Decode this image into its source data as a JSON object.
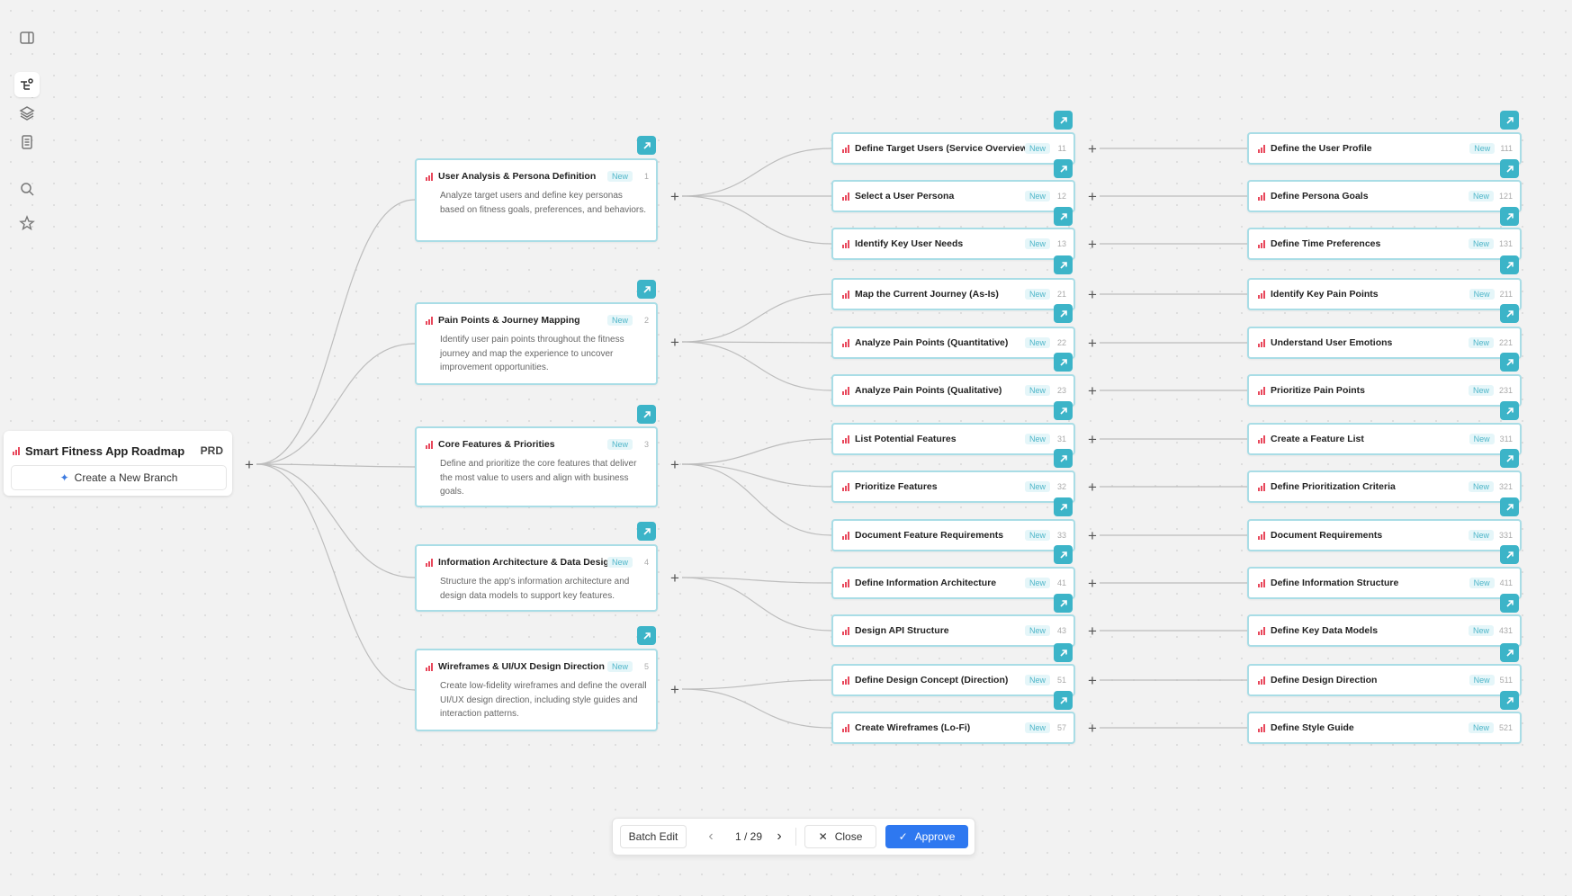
{
  "app": {
    "root": {
      "title": "Smart Fitness App Roadmap",
      "tag": "PRD",
      "branch_label": "Create a New Branch"
    },
    "rail_icons": [
      "sidebar-toggle-icon",
      "mindmap-icon",
      "layers-icon",
      "document-icon",
      "search-icon",
      "star-icon"
    ],
    "colors": {
      "accent": "#3cb4c8",
      "node_border": "#a9dde6",
      "badge_text": "#4fb6c9",
      "priority": "#e8475b",
      "approve": "#2e78f0"
    }
  },
  "nodes": [
    {
      "id": "1",
      "title": "User Analysis & Persona Definition",
      "badge": "New",
      "num": "1",
      "desc": "Analyze target users and define key personas based on fitness goals, preferences, and behaviors.",
      "children": [
        {
          "id": "11",
          "title": "Define Target Users (Service Overview)",
          "badge": "New",
          "num": "11",
          "leaf": {
            "title": "Define the User Profile",
            "badge": "New",
            "num": "111"
          }
        },
        {
          "id": "12",
          "title": "Select a User Persona",
          "badge": "New",
          "num": "12",
          "leaf": {
            "title": "Define Persona Goals",
            "badge": "New",
            "num": "121"
          }
        },
        {
          "id": "13",
          "title": "Identify Key User Needs",
          "badge": "New",
          "num": "13",
          "leaf": {
            "title": "Define Time Preferences",
            "badge": "New",
            "num": "131"
          }
        }
      ]
    },
    {
      "id": "2",
      "title": "Pain Points & Journey Mapping",
      "badge": "New",
      "num": "2",
      "desc": "Identify user pain points throughout the fitness journey and map the experience to uncover improvement opportunities.",
      "children": [
        {
          "id": "21",
          "title": "Map the Current Journey (As-Is)",
          "badge": "New",
          "num": "21",
          "leaf": {
            "title": "Identify Key Pain Points",
            "badge": "New",
            "num": "211"
          }
        },
        {
          "id": "22",
          "title": "Analyze Pain Points (Quantitative)",
          "badge": "New",
          "num": "22",
          "leaf": {
            "title": "Understand User Emotions",
            "badge": "New",
            "num": "221"
          }
        },
        {
          "id": "23",
          "title": "Analyze Pain Points (Qualitative)",
          "badge": "New",
          "num": "23",
          "leaf": {
            "title": "Prioritize Pain Points",
            "badge": "New",
            "num": "231"
          }
        }
      ]
    },
    {
      "id": "3",
      "title": "Core Features & Priorities",
      "badge": "New",
      "num": "3",
      "desc": "Define and prioritize the core features that deliver the most value to users and align with business goals.",
      "children": [
        {
          "id": "31",
          "title": "List Potential Features",
          "badge": "New",
          "num": "31",
          "leaf": {
            "title": "Create a Feature List",
            "badge": "New",
            "num": "311"
          }
        },
        {
          "id": "32",
          "title": "Prioritize Features",
          "badge": "New",
          "num": "32",
          "leaf": {
            "title": "Define Prioritization Criteria",
            "badge": "New",
            "num": "321"
          }
        },
        {
          "id": "33",
          "title": "Document Feature Requirements",
          "badge": "New",
          "num": "33",
          "leaf": {
            "title": "Document Requirements",
            "badge": "New",
            "num": "331"
          }
        }
      ]
    },
    {
      "id": "4",
      "title": "Information Architecture & Data Design",
      "badge": "New",
      "num": "4",
      "desc": "Structure the app's information architecture and design data models to support key features.",
      "children": [
        {
          "id": "41",
          "title": "Define Information Architecture",
          "badge": "New",
          "num": "41",
          "leaf": {
            "title": "Define Information Structure",
            "badge": "New",
            "num": "411"
          }
        },
        {
          "id": "43",
          "title": "Design API Structure",
          "badge": "New",
          "num": "43",
          "leaf": {
            "title": "Define Key Data Models",
            "badge": "New",
            "num": "431"
          }
        }
      ]
    },
    {
      "id": "5",
      "title": "Wireframes & UI/UX Design Direction",
      "badge": "New",
      "num": "5",
      "desc": "Create low-fidelity wireframes and define the overall UI/UX design direction, including style guides and interaction patterns.",
      "children": [
        {
          "id": "51",
          "title": "Define Design Concept (Direction)",
          "badge": "New",
          "num": "51",
          "leaf": {
            "title": "Define Design Direction",
            "badge": "New",
            "num": "511"
          }
        },
        {
          "id": "57",
          "title": "Create Wireframes (Lo-Fi)",
          "badge": "New",
          "num": "57",
          "leaf": {
            "title": "Define Style Guide",
            "badge": "New",
            "num": "521"
          }
        }
      ]
    }
  ],
  "toolbar": {
    "batch_edit": "Batch Edit",
    "page": "1 / 29",
    "close": "Close",
    "approve": "Approve"
  }
}
